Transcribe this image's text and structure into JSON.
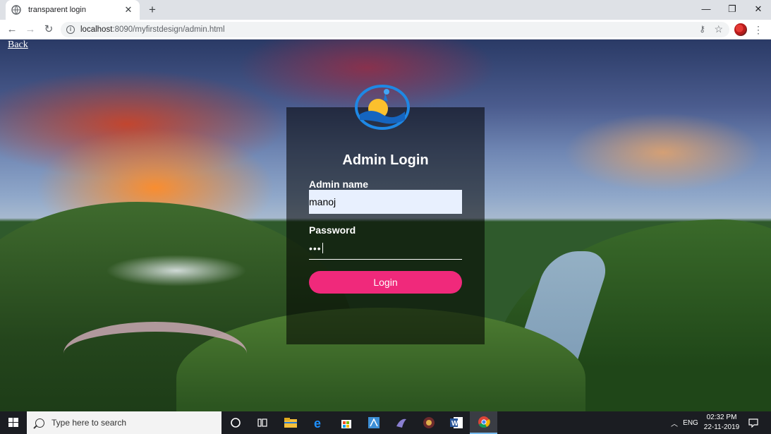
{
  "browser": {
    "tab_title": "transparent login",
    "url_host": "localhost",
    "url_path": ":8090/myfirstdesign/admin.html"
  },
  "page": {
    "back_link": "Back",
    "title": "Admin Login",
    "name_label": "Admin name",
    "name_value": "manoj",
    "password_label": "Password",
    "password_mask": "•••",
    "login_button": "Login"
  },
  "taskbar": {
    "search_placeholder": "Type here to search",
    "language": "ENG",
    "time": "02:32 PM",
    "date": "22-11-2019"
  },
  "colors": {
    "accent": "#f0297b",
    "input_bg": "#e8f0fe"
  }
}
